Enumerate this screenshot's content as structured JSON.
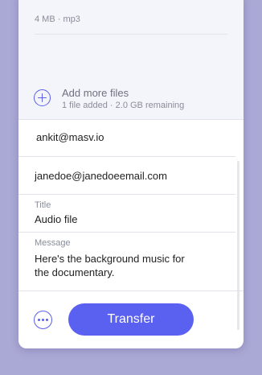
{
  "files": {
    "first_file_meta": "4 MB · mp3",
    "add_more_label": "Add more files",
    "add_more_status": "1 file added · 2.0 GB remaining"
  },
  "form": {
    "from_value": "ankit@masv.io",
    "to_value": "janedoe@janedoeemail.com",
    "title_label": "Title",
    "title_value": "Audio file",
    "message_label": "Message",
    "message_line1": "Here's the background music for",
    "message_line2": "the documentary."
  },
  "actions": {
    "more_icon": "more-horizontal-icon",
    "transfer_label": "Transfer"
  },
  "colors": {
    "accent": "#5a60f0",
    "background": "#aaa8d4"
  }
}
